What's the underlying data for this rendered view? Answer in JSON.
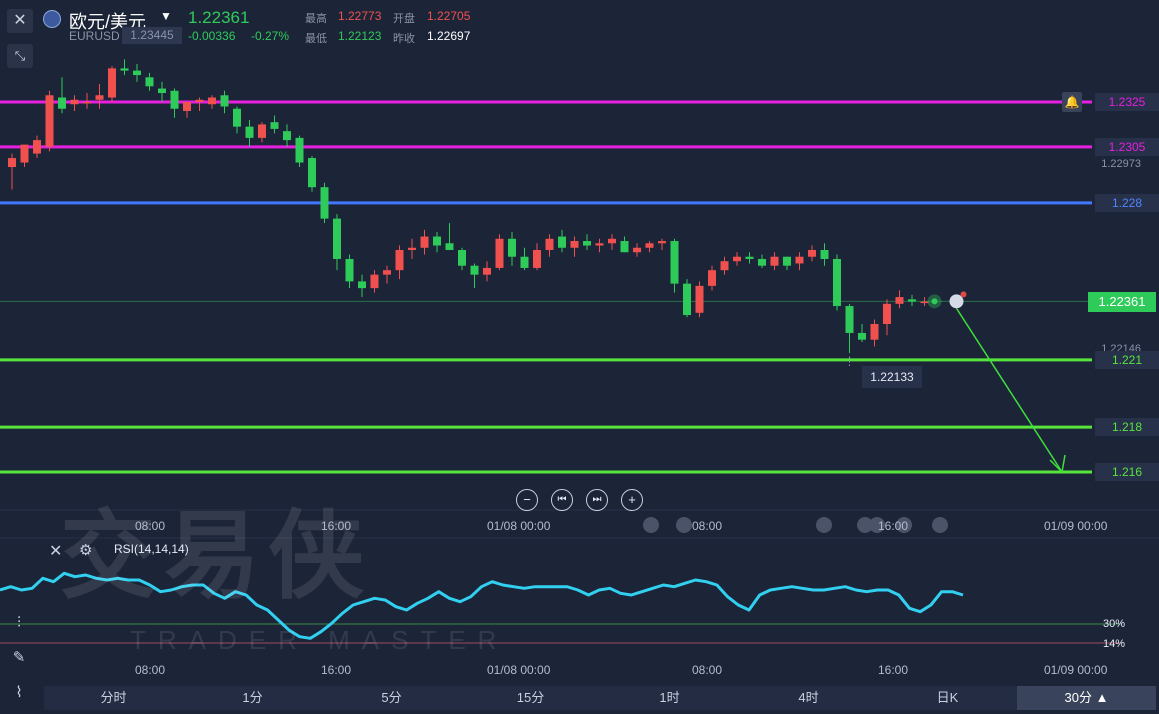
{
  "header": {
    "symbol_name": "欧元/美元",
    "symbol_code": "EURUSD",
    "last_price": "1.22361",
    "change": "-0.00336",
    "change_pct": "-0.27%",
    "high_label": "最高",
    "high_value": "1.22773",
    "low_label": "最低",
    "low_value": "1.22123",
    "open_label": "开盘",
    "open_value": "1.22705",
    "prev_close_label": "昨收",
    "prev_close_value": "1.22697",
    "tooltip_price": "1.23445"
  },
  "price_levels": {
    "magenta_1": "1.2325",
    "magenta_2": "1.2305",
    "grey_1": "1.22973",
    "blue": "1.228",
    "current": "1.22361",
    "grey_2": "1.22146",
    "green_1": "1.221",
    "green_2": "1.218",
    "green_3": "1.216",
    "low_marker": "1.22133"
  },
  "time_axis": {
    "labels": [
      "08:00",
      "16:00",
      "01/08 00:00",
      "08:00",
      "16:00",
      "01/09 00:00"
    ]
  },
  "rsi": {
    "title": "RSI(14,14,14)",
    "level_high": "30%",
    "level_low": "14%"
  },
  "watermark": {
    "main": "交易侠",
    "sub": "TRADER MASTER"
  },
  "timeframes": [
    "分时",
    "1分",
    "5分",
    "15分",
    "1时",
    "4时",
    "日K",
    "30分"
  ],
  "active_timeframe": "30分",
  "colors": {
    "background": "#1c2438",
    "up": "#f0514f",
    "down": "#2fcb5a",
    "magenta_line": "#e61fe0",
    "blue_line": "#4277ff",
    "green_line": "#57e43c",
    "rsi_line": "#32d0f0"
  },
  "chart_data": {
    "type": "candlestick",
    "series": [
      {
        "name": "EURUSD",
        "ohlc_points": [
          [
            1.2296,
            1.2302,
            1.2286,
            1.23
          ],
          [
            1.2298,
            1.2305,
            1.2296,
            1.2306
          ],
          [
            1.2302,
            1.231,
            1.23,
            1.2308
          ],
          [
            1.2305,
            1.233,
            1.2303,
            1.2328
          ],
          [
            1.2327,
            1.2336,
            1.232,
            1.2322
          ],
          [
            1.2324,
            1.2328,
            1.2321,
            1.2326
          ],
          [
            1.2325,
            1.2329,
            1.2322,
            1.2325
          ],
          [
            1.2326,
            1.2333,
            1.2322,
            1.2328
          ],
          [
            1.2327,
            1.2341,
            1.2325,
            1.234
          ],
          [
            1.234,
            1.2344,
            1.2337,
            1.2339
          ],
          [
            1.2339,
            1.2342,
            1.2334,
            1.2337
          ],
          [
            1.2336,
            1.2338,
            1.233,
            1.2332
          ],
          [
            1.2331,
            1.2334,
            1.2325,
            1.2329
          ],
          [
            1.233,
            1.2331,
            1.2318,
            1.2322
          ],
          [
            1.2321,
            1.2325,
            1.2318,
            1.2325
          ],
          [
            1.2325,
            1.2327,
            1.2321,
            1.2326
          ],
          [
            1.2324,
            1.2328,
            1.2322,
            1.2327
          ],
          [
            1.2328,
            1.233,
            1.232,
            1.2323
          ],
          [
            1.2322,
            1.2323,
            1.2311,
            1.2314
          ],
          [
            1.2314,
            1.2317,
            1.2305,
            1.2309
          ],
          [
            1.2309,
            1.2316,
            1.2307,
            1.2315
          ],
          [
            1.2316,
            1.2319,
            1.2311,
            1.2313
          ],
          [
            1.2312,
            1.2315,
            1.2305,
            1.2308
          ],
          [
            1.2309,
            1.231,
            1.2296,
            1.2298
          ],
          [
            1.23,
            1.2301,
            1.2285,
            1.2287
          ],
          [
            1.2287,
            1.2289,
            1.2271,
            1.2273
          ],
          [
            1.2273,
            1.2275,
            1.225,
            1.2255
          ],
          [
            1.2255,
            1.2257,
            1.2242,
            1.2245
          ],
          [
            1.2245,
            1.2248,
            1.2238,
            1.2242
          ],
          [
            1.2242,
            1.225,
            1.224,
            1.2248
          ],
          [
            1.2248,
            1.2252,
            1.2244,
            1.225
          ],
          [
            1.225,
            1.2261,
            1.2246,
            1.2259
          ],
          [
            1.2259,
            1.2264,
            1.2255,
            1.226
          ],
          [
            1.226,
            1.2268,
            1.2257,
            1.2265
          ],
          [
            1.2265,
            1.2267,
            1.2258,
            1.2261
          ],
          [
            1.2262,
            1.2271,
            1.2259,
            1.2259
          ],
          [
            1.2259,
            1.226,
            1.225,
            1.2252
          ],
          [
            1.2252,
            1.2253,
            1.2242,
            1.2248
          ],
          [
            1.2248,
            1.2254,
            1.2245,
            1.2251
          ],
          [
            1.2251,
            1.2266,
            1.225,
            1.2264
          ],
          [
            1.2264,
            1.2267,
            1.2252,
            1.2256
          ],
          [
            1.2256,
            1.226,
            1.225,
            1.2251
          ],
          [
            1.2251,
            1.2262,
            1.225,
            1.2259
          ],
          [
            1.2259,
            1.2266,
            1.2256,
            1.2264
          ],
          [
            1.2265,
            1.2268,
            1.2258,
            1.226
          ],
          [
            1.226,
            1.2265,
            1.2256,
            1.2263
          ],
          [
            1.2263,
            1.2266,
            1.2259,
            1.2261
          ],
          [
            1.2261,
            1.2264,
            1.2258,
            1.2262
          ],
          [
            1.2262,
            1.2266,
            1.2259,
            1.2264
          ],
          [
            1.2263,
            1.2265,
            1.2258,
            1.2258
          ],
          [
            1.2258,
            1.2262,
            1.2256,
            1.226
          ],
          [
            1.226,
            1.2263,
            1.2258,
            1.2262
          ],
          [
            1.2262,
            1.2264,
            1.2259,
            1.2263
          ],
          [
            1.2263,
            1.2264,
            1.224,
            1.2244
          ],
          [
            1.2244,
            1.2246,
            1.2229,
            1.223
          ],
          [
            1.2231,
            1.2245,
            1.2229,
            1.2243
          ],
          [
            1.2243,
            1.2252,
            1.2241,
            1.225
          ],
          [
            1.225,
            1.2256,
            1.2248,
            1.2254
          ],
          [
            1.2254,
            1.2258,
            1.2252,
            1.2256
          ],
          [
            1.2256,
            1.2258,
            1.2253,
            1.2255
          ],
          [
            1.2255,
            1.2257,
            1.2251,
            1.2252
          ],
          [
            1.2252,
            1.2258,
            1.225,
            1.2256
          ],
          [
            1.2256,
            1.2256,
            1.225,
            1.2252
          ],
          [
            1.2253,
            1.2258,
            1.225,
            1.2256
          ],
          [
            1.2256,
            1.2261,
            1.2254,
            1.2259
          ],
          [
            1.2259,
            1.2262,
            1.2252,
            1.2255
          ],
          [
            1.2255,
            1.2257,
            1.2232,
            1.2234
          ],
          [
            1.2234,
            1.2235,
            1.2213,
            1.2222
          ],
          [
            1.2222,
            1.2226,
            1.2218,
            1.2219
          ],
          [
            1.2219,
            1.2228,
            1.2216,
            1.2226
          ],
          [
            1.2226,
            1.2237,
            1.2221,
            1.2235
          ],
          [
            1.2235,
            1.2241,
            1.2233,
            1.2238
          ],
          [
            1.2237,
            1.2239,
            1.2234,
            1.2236
          ],
          [
            1.2236,
            1.2238,
            1.2234,
            1.2236
          ]
        ]
      }
    ],
    "candle_order": "open, high, low, close",
    "x_range": [
      "",
      "01/09 00:00"
    ],
    "y_range": [
      1.2155,
      1.235
    ],
    "rsi_series": [
      42,
      44,
      42,
      43,
      49,
      47,
      52,
      50,
      51,
      49,
      48,
      49,
      48,
      48,
      45,
      41,
      42,
      44,
      45,
      45,
      40,
      37,
      41,
      39,
      33,
      30,
      24,
      18,
      14,
      13,
      17,
      22,
      28,
      33,
      35,
      37,
      36,
      32,
      30,
      34,
      37,
      41,
      37,
      35,
      38,
      44,
      47,
      45,
      44,
      43,
      44,
      44,
      44,
      44,
      42,
      39,
      42,
      43,
      40,
      39,
      41,
      43,
      45,
      44,
      46,
      48,
      47,
      45,
      38,
      33,
      30,
      39,
      42,
      43,
      44,
      43,
      42,
      42,
      43,
      44,
      42,
      41,
      42,
      42,
      39,
      31,
      29,
      33,
      41,
      41,
      39
    ],
    "rsi_y_range": [
      0,
      60
    ],
    "horizontal_levels": [
      1.2325,
      1.2305,
      1.228,
      1.221,
      1.218,
      1.216
    ],
    "grid": false
  }
}
